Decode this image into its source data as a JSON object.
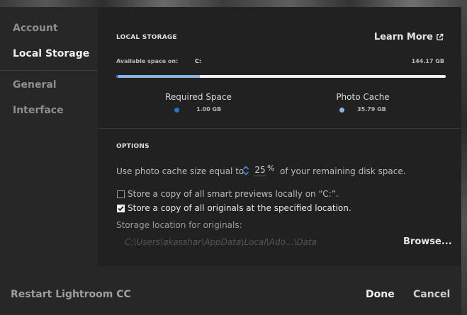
{
  "sidebar": {
    "items": [
      {
        "label": "Account",
        "active": false
      },
      {
        "label": "Local Storage",
        "active": true
      },
      {
        "label": "General",
        "active": false
      },
      {
        "label": "Interface",
        "active": false
      }
    ]
  },
  "local_storage": {
    "title": "LOCAL STORAGE",
    "learn_more": "Learn More",
    "available_label": "Available space on:",
    "drive": "C:",
    "total": "144.17 GB",
    "usage_bar": {
      "required_fraction": 0.0069,
      "cache_fraction": 0.248
    },
    "required": {
      "label": "Required Space",
      "value": "1.00 GB",
      "color": "#2d6fcf"
    },
    "cache": {
      "label": "Photo Cache",
      "value": "35.79 GB",
      "color": "#8fb3df"
    }
  },
  "options": {
    "title": "OPTIONS",
    "cache_prefix": "Use photo cache size equal to",
    "cache_percent": "25",
    "percent_sign": "%",
    "cache_suffix": "of your remaining disk space.",
    "smart_previews": {
      "label": "Store a copy of all smart previews locally on “C:”.",
      "checked": false
    },
    "originals": {
      "label": "Store a copy of all originals at the specified location.",
      "checked": true
    },
    "storage_location_label": "Storage location for originals:",
    "storage_path": "C:\\Users\\akasshar\\AppData\\Local\\Ado...\\Data",
    "browse": "Browse..."
  },
  "footer": {
    "restart": "Restart Lightroom CC",
    "done": "Done",
    "cancel": "Cancel"
  },
  "icons": {
    "external_link": "external-link-icon",
    "stepper": "up-down-arrows-icon",
    "checkmark": "checkmark-icon"
  },
  "colors": {
    "accent": "#2d6fcf",
    "cache": "#8fb3df"
  }
}
